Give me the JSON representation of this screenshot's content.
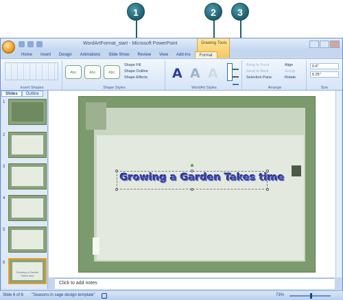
{
  "window": {
    "title": "WordArtFormat_start - Microsoft PowerPoint",
    "context_tab_group": "Drawing Tools"
  },
  "tabs": [
    "Home",
    "Insert",
    "Design",
    "Animations",
    "Slide Show",
    "Review",
    "View",
    "Add-Ins",
    "Format"
  ],
  "active_tab": "Format",
  "ribbon": {
    "insert_shapes_label": "Insert Shapes",
    "shape_styles_label": "Shape Styles",
    "style_sample": "Abc",
    "shape_fill": "Shape Fill",
    "shape_outline": "Shape Outline",
    "shape_effects": "Shape Effects",
    "wordart_styles_label": "WordArt Styles",
    "wordart_letter": "A",
    "arrange_label": "Arrange",
    "bring_to_front": "Bring to Front",
    "send_to_back": "Send to Back",
    "selection_pane": "Selection Pane",
    "align": "Align",
    "group": "Group",
    "rotate": "Rotate",
    "size_label": "Size",
    "height": "0.6\"",
    "width": "6.25\""
  },
  "left_pane": {
    "tab_slides": "Slides",
    "tab_outline": "Outline",
    "thumb_numbers": [
      "1",
      "2",
      "3",
      "4",
      "5",
      "6"
    ],
    "thumb6_text": "Growing a Garden Takes time"
  },
  "slide": {
    "wordart_text": "Growing a Garden Takes time"
  },
  "notes": {
    "placeholder": "Click to add notes"
  },
  "status": {
    "slide": "Slide 6 of 6",
    "theme": "\"Seasons in sage design template\"",
    "zoom": "73%"
  },
  "callouts": [
    "1",
    "2",
    "3"
  ]
}
